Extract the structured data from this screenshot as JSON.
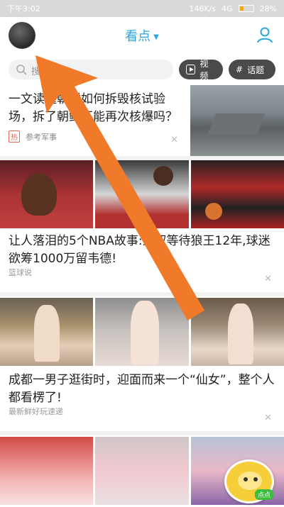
{
  "status_bar": {
    "time": "下午3:02",
    "network": "146K/s",
    "signal": "4G",
    "battery": "28%"
  },
  "topbar": {
    "title": "看点"
  },
  "search": {
    "placeholder": "搜",
    "video_label": "视频",
    "topic_label": "话题"
  },
  "feed": [
    {
      "title": "一文读懂朝鲜如何拆毁核试验场，拆了朝鲜还能再次核爆吗？",
      "tag": "热",
      "source": "参考军事"
    },
    {
      "title": "让人落泪的5个NBA故事:为叔等待狼王12年,球迷欲筹1000万留韦德!",
      "source": "篮球说"
    },
    {
      "title": "成都一男子逛街时，迎面而来一个“仙女”，整个人都看楞了!",
      "source": "最新鲜好玩速递"
    }
  ],
  "mascot": {
    "badge": "点点"
  },
  "colors": {
    "accent": "#2aa6d8",
    "arrow": "#f07a2a"
  }
}
